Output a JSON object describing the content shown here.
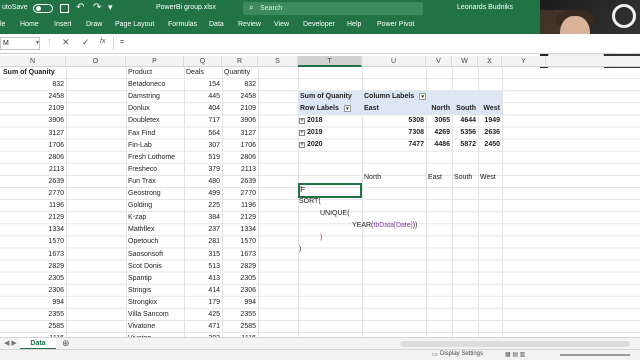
{
  "titlebar": {
    "autosave_label": "utoSave",
    "filename": "PowerBi group.xlsx",
    "search_placeholder": "Search",
    "user": "Leonards Budniks"
  },
  "ribbon": {
    "tabs": [
      "le",
      "Home",
      "Insert",
      "Draw",
      "Page Layout",
      "Formulas",
      "Data",
      "Review",
      "View",
      "Developer",
      "Help",
      "Power Pivot"
    ]
  },
  "formulabar": {
    "namebox": "M",
    "fx_label": "fx",
    "value": "="
  },
  "columns": [
    "N",
    "O",
    "P",
    "Q",
    "R",
    "S",
    "T",
    "U",
    "V",
    "W",
    "X",
    "Y"
  ],
  "left_table": {
    "header_n": "Sum of Quanity",
    "header_product": "Product",
    "header_deals": "Deals",
    "header_quantity": "Quantity",
    "sums": [
      "832",
      "2458",
      "2109",
      "3906",
      "3127",
      "1706",
      "2806",
      "2113",
      "2639",
      "2770",
      "1196",
      "2129",
      "1334",
      "1570",
      "1673",
      "2829",
      "2305",
      "2306",
      "994",
      "2355",
      "2585",
      "1115"
    ],
    "rows": [
      {
        "product": "Betadoneco",
        "deals": "154",
        "quantity": "832"
      },
      {
        "product": "Damstring",
        "deals": "445",
        "quantity": "2458"
      },
      {
        "product": "Donlux",
        "deals": "404",
        "quantity": "2109"
      },
      {
        "product": "Doubletex",
        "deals": "717",
        "quantity": "3906"
      },
      {
        "product": "Fax Find",
        "deals": "564",
        "quantity": "3127"
      },
      {
        "product": "Fin-Lab",
        "deals": "307",
        "quantity": "1706"
      },
      {
        "product": "Fresh Lothome",
        "deals": "519",
        "quantity": "2806"
      },
      {
        "product": "Fresheco",
        "deals": "379",
        "quantity": "2113"
      },
      {
        "product": "Fun Trax",
        "deals": "480",
        "quantity": "2639"
      },
      {
        "product": "Geostrong",
        "deals": "499",
        "quantity": "2770"
      },
      {
        "product": "Golding",
        "deals": "225",
        "quantity": "1196"
      },
      {
        "product": "K-zap",
        "deals": "384",
        "quantity": "2129"
      },
      {
        "product": "Mathflex",
        "deals": "237",
        "quantity": "1334"
      },
      {
        "product": "Opetouch",
        "deals": "281",
        "quantity": "1570"
      },
      {
        "product": "Saosonsoft",
        "deals": "315",
        "quantity": "1673"
      },
      {
        "product": "Scot Donis",
        "deals": "513",
        "quantity": "2829"
      },
      {
        "product": "Spantip",
        "deals": "413",
        "quantity": "2305"
      },
      {
        "product": "Stringis",
        "deals": "414",
        "quantity": "2306"
      },
      {
        "product": "Strongkix",
        "deals": "179",
        "quantity": "994"
      },
      {
        "product": "Villa Sancom",
        "deals": "425",
        "quantity": "2355"
      },
      {
        "product": "Vivatone",
        "deals": "471",
        "quantity": "2585"
      },
      {
        "product": "Vivatop",
        "deals": "202",
        "quantity": "1115"
      }
    ]
  },
  "pivot": {
    "corner": "Sum of Quanity",
    "column_labels": "Column Labels",
    "row_labels": "Row Labels",
    "regions": [
      "East",
      "North",
      "South",
      "West"
    ],
    "rows": [
      {
        "year": "2018",
        "values": [
          "5308",
          "3065",
          "4644",
          "1949"
        ]
      },
      {
        "year": "2019",
        "values": [
          "7308",
          "4269",
          "5356",
          "2636"
        ]
      },
      {
        "year": "2020",
        "values": [
          "7477",
          "4486",
          "5872",
          "2450"
        ]
      }
    ]
  },
  "header_row2": [
    "North",
    "East",
    "South",
    "West"
  ],
  "formula_lines": {
    "l1": "=",
    "l2": "SORT(",
    "l3": "UNIQUE(",
    "l4_fn": "YEAR(",
    "l4_ref": "tbData[Date]",
    "l4_close": "))",
    "l5": ")",
    "l6": ")"
  },
  "sheetbar": {
    "sheet": "Data"
  },
  "statusbar": {
    "display_settings": "Display Settings"
  },
  "colors": {
    "excel_green": "#217346",
    "pivot_header": "#dde6f4"
  }
}
